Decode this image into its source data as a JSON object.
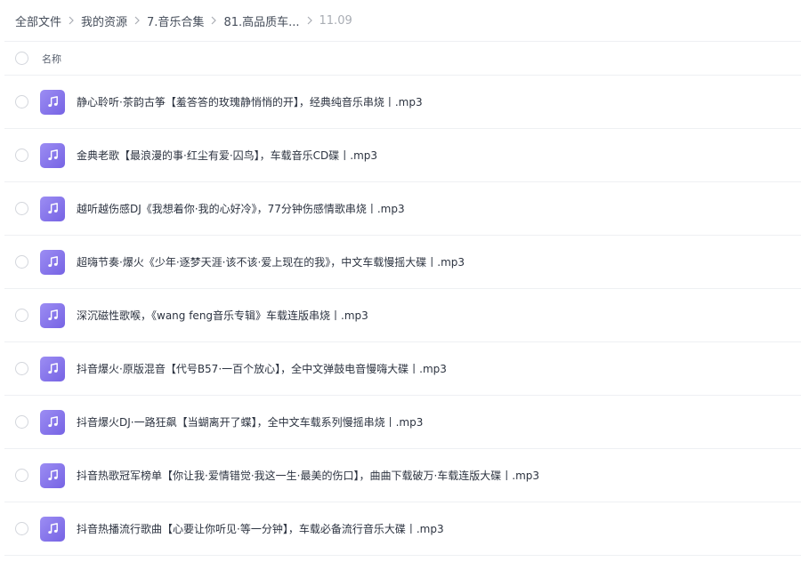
{
  "breadcrumb": {
    "items": [
      {
        "label": "全部文件"
      },
      {
        "label": "我的资源"
      },
      {
        "label": "7.音乐合集"
      },
      {
        "label": "81.高品质车..."
      },
      {
        "label": "11.09"
      }
    ]
  },
  "list_header": {
    "name_label": "名称"
  },
  "files": [
    {
      "name": "静心聆听·茶韵古筝【羞答答的玫瑰静悄悄的开】，经典纯音乐串烧丨.mp3",
      "icon": "music-note-icon"
    },
    {
      "name": "金典老歌【最浪漫的事·红尘有爱·囚鸟】，车载音乐CD碟丨.mp3",
      "icon": "music-note-icon"
    },
    {
      "name": "越听越伤感DJ《我想着你·我的心好冷》，77分钟伤感情歌串烧丨.mp3",
      "icon": "music-note-icon"
    },
    {
      "name": "超嗨节奏·爆火《少年·逐梦天涯·该不该·爱上现在的我》，中文车载慢摇大碟丨.mp3",
      "icon": "music-note-icon"
    },
    {
      "name": "深沉磁性歌喉，《wang feng音乐专辑》车载连版串烧丨.mp3",
      "icon": "music-note-icon"
    },
    {
      "name": "抖音爆火·原版混音【代号B57·一百个放心】，全中文弹鼓电音慢嗨大碟丨.mp3",
      "icon": "music-note-icon"
    },
    {
      "name": "抖音爆火DJ·一路狂飙【当蝴离开了蝶】，全中文车载系列慢摇串烧丨.mp3",
      "icon": "music-note-icon"
    },
    {
      "name": "抖音热歌冠军榜单【你让我·爱情错觉·我这一生·最美的伤口】，曲曲下载破万·车载连版大碟丨.mp3",
      "icon": "music-note-icon"
    },
    {
      "name": "抖音热播流行歌曲【心要让你听见·等一分钟】，车载必备流行音乐大碟丨.mp3",
      "icon": "music-note-icon"
    }
  ],
  "colors": {
    "icon_gradient_start": "#9c8df3",
    "icon_gradient_end": "#7663e4",
    "divider": "#eef0f3",
    "muted_text": "#a9adb4"
  }
}
